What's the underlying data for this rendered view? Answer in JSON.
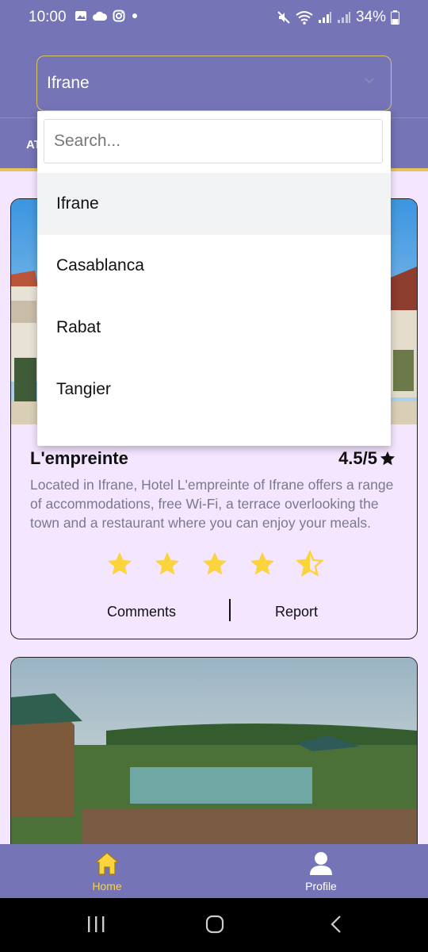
{
  "status_bar": {
    "time": "10:00",
    "battery": "34%"
  },
  "header": {
    "selected_city": "Ifrane",
    "tab_fragment": "AT"
  },
  "dropdown": {
    "search_placeholder": "Search...",
    "options": [
      "Ifrane",
      "Casablanca",
      "Rabat",
      "Tangier"
    ],
    "selected_index": 0
  },
  "hotels": [
    {
      "name": "L'empreinte",
      "rating_text": "4.5/5",
      "rating": 4.5,
      "description": "Located in Ifrane, Hotel L'empreinte of Ifrane offers a range of accommodations, free Wi-Fi, a terrace overlooking the town and a restaurant where you can enjoy your meals.",
      "comments_label": "Comments",
      "report_label": "Report"
    }
  ],
  "bottom_nav": {
    "home_label": "Home",
    "profile_label": "Profile"
  },
  "colors": {
    "primary": "#7474b6",
    "accent": "#e8c35a",
    "star": "#fbd33d",
    "background": "#f4e6ff"
  },
  "icons": [
    "image-icon",
    "cloud-icon",
    "instagram-icon",
    "mute-icon",
    "wifi-icon",
    "signal-icon",
    "battery-icon",
    "chevron-down-icon",
    "star-icon",
    "home-icon",
    "person-icon",
    "recents-icon",
    "home-circle-icon",
    "back-icon"
  ]
}
